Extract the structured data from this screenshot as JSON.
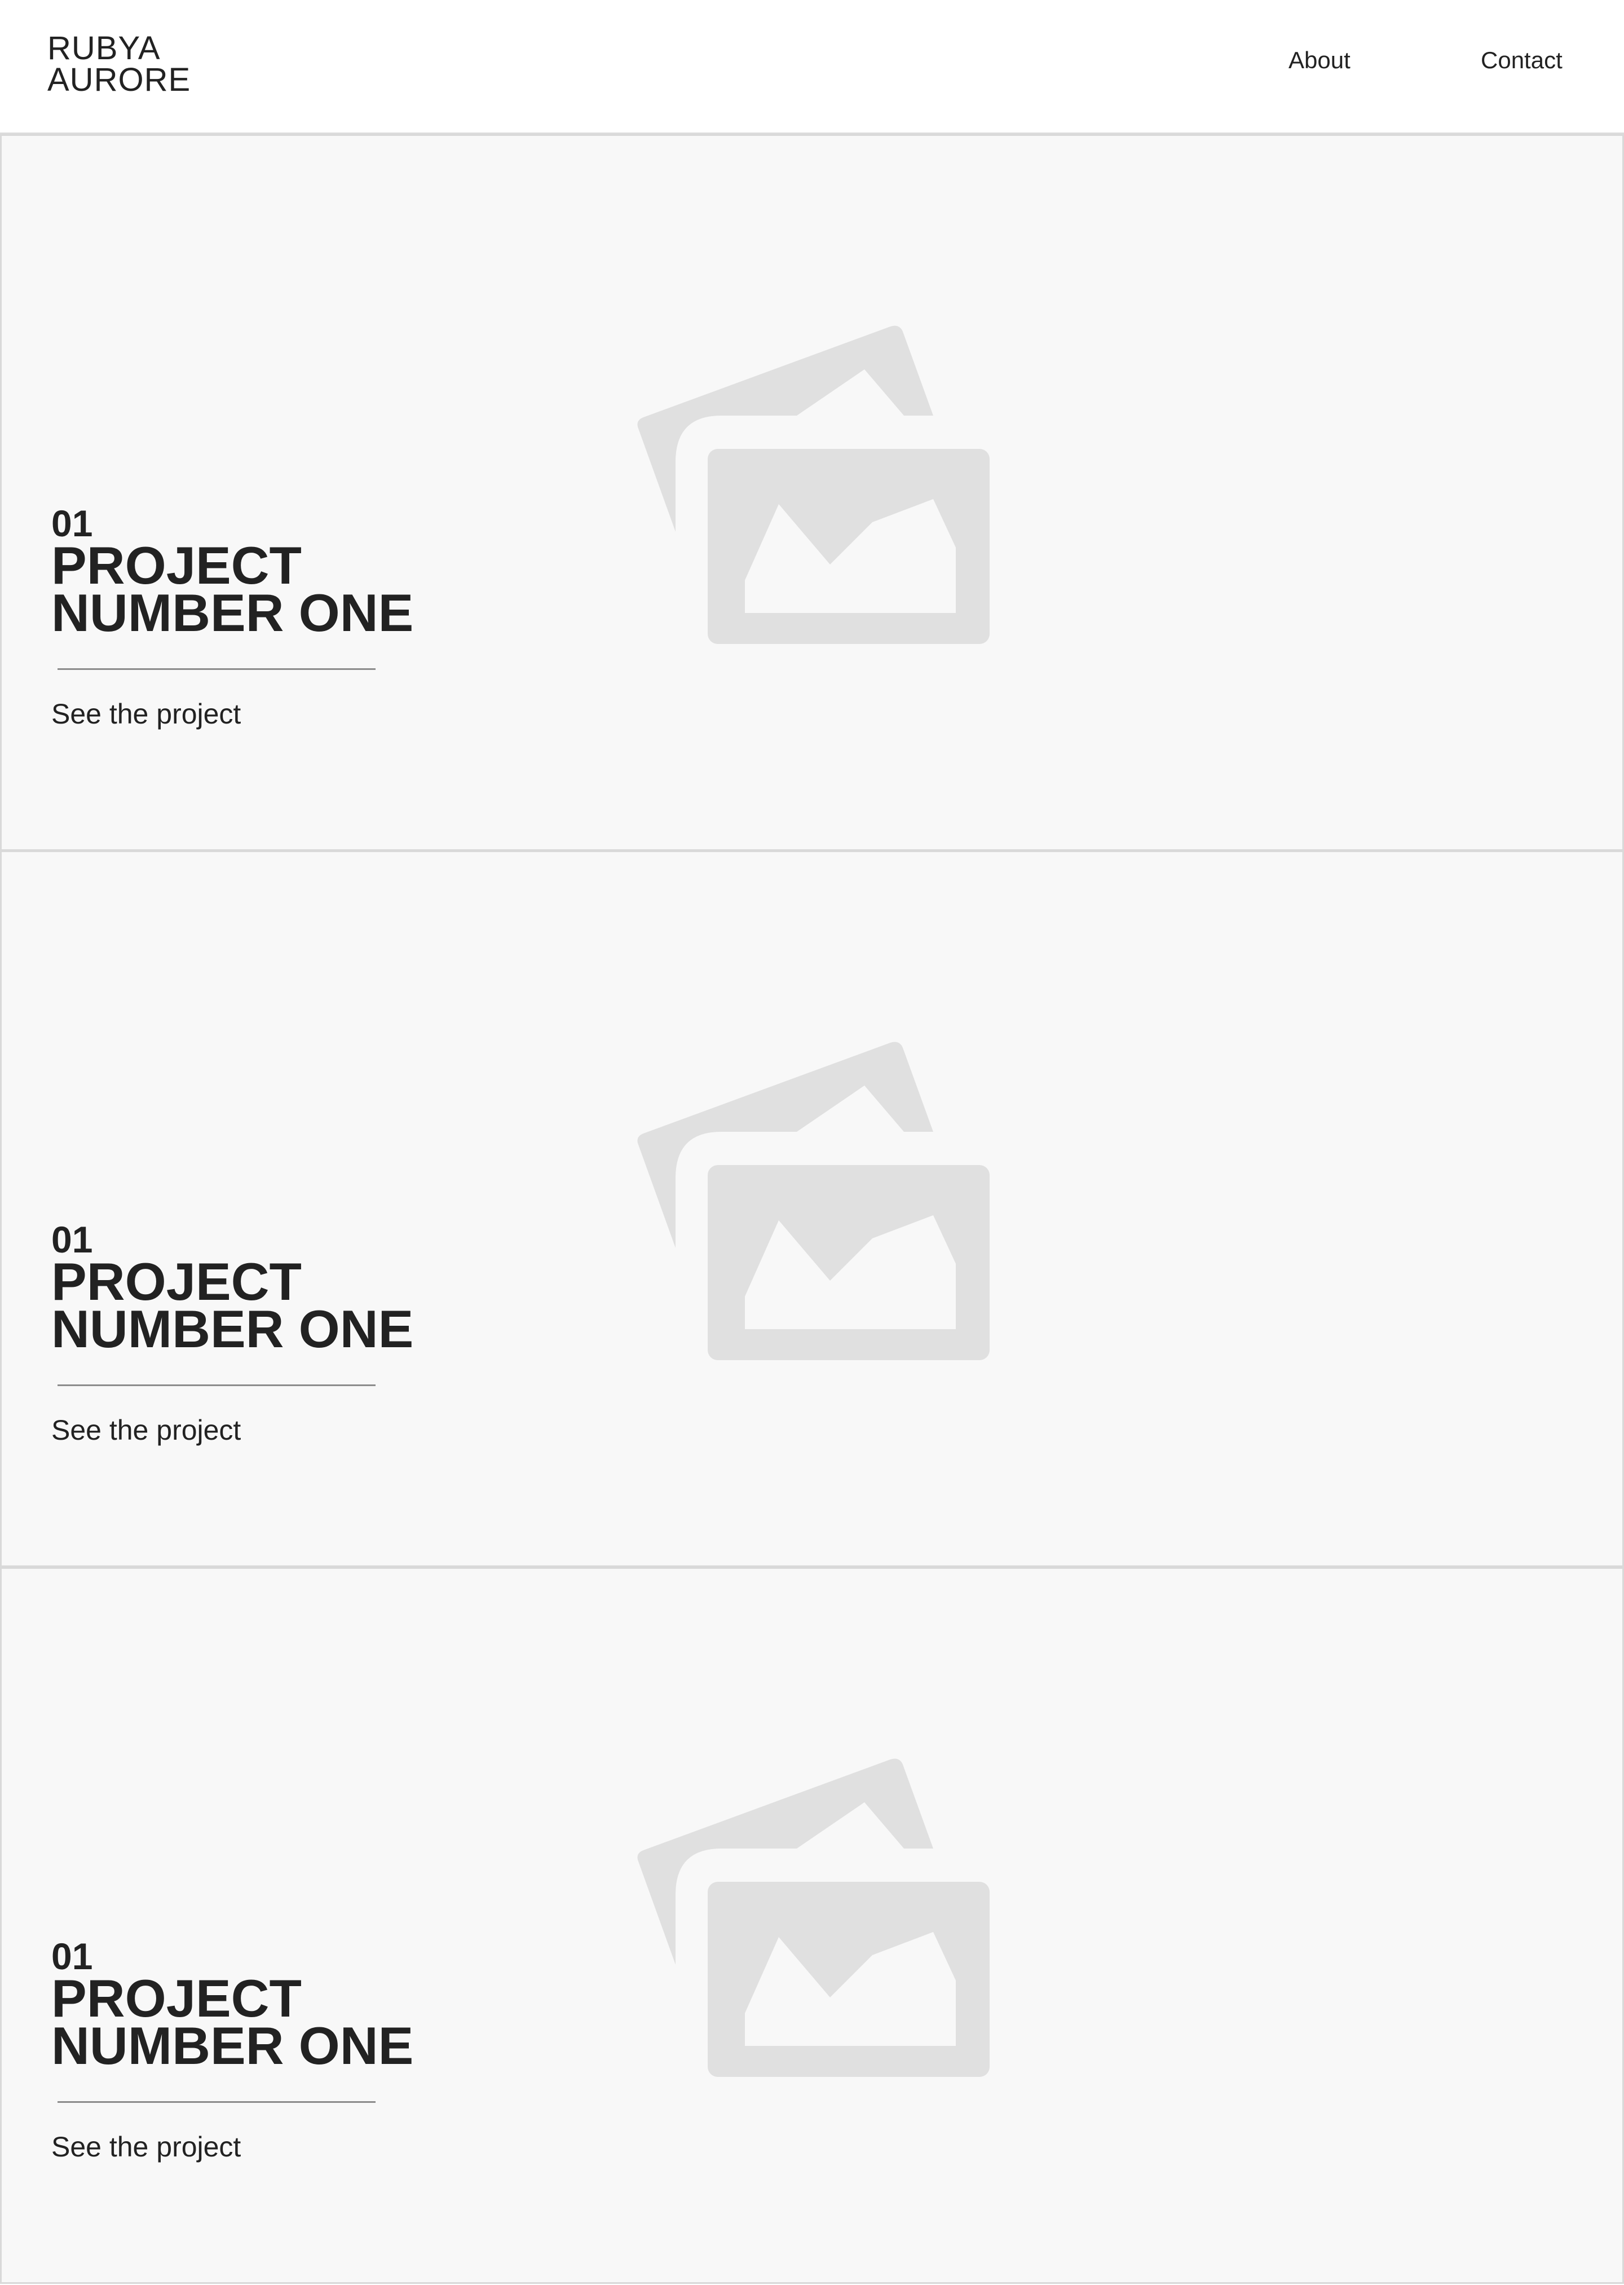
{
  "header": {
    "brand_line1": "RUBYA",
    "brand_line2": "AURORE",
    "nav": {
      "about": "About",
      "contact": "Contact"
    }
  },
  "projects": [
    {
      "number": "01",
      "title_line1": "PROJECT",
      "title_line2": "NUMBER ONE",
      "cta": "See the project",
      "image_icon": "image-placeholder-icon"
    },
    {
      "number": "01",
      "title_line1": "PROJECT",
      "title_line2": "NUMBER ONE",
      "cta": "See the project",
      "image_icon": "image-placeholder-icon"
    },
    {
      "number": "01",
      "title_line1": "PROJECT",
      "title_line2": "NUMBER ONE",
      "cta": "See the project",
      "image_icon": "image-placeholder-icon"
    }
  ],
  "colors": {
    "text": "#222222",
    "section_bg": "#f8f8f8",
    "placeholder_icon": "#e0e0e0",
    "divider": "#d9d9d9"
  }
}
